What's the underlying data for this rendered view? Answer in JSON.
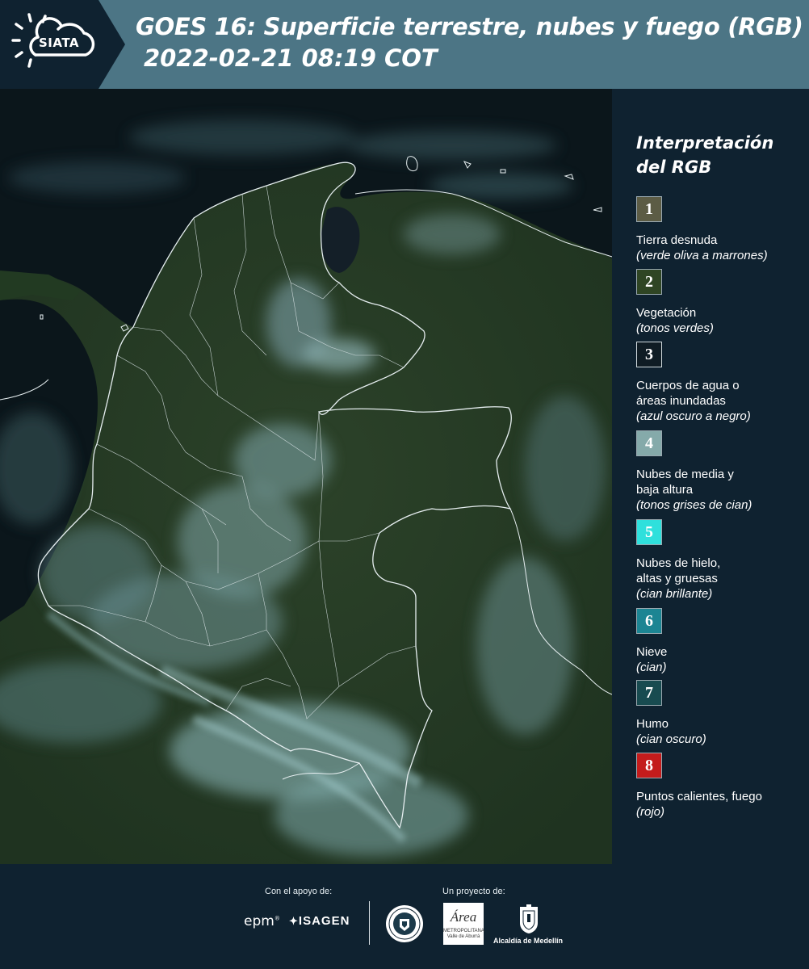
{
  "header": {
    "logo_text": "SIATA",
    "title_line1": "GOES 16: Superficie terrestre, nubes y fuego (RGB)",
    "title_line2": "2022-02-21 08:19 COT"
  },
  "legend": {
    "title": "Interpretación del RGB",
    "items": [
      {
        "number": "1",
        "label": "Tierra desnuda",
        "sub": "(verde oliva a marrones)",
        "color": "#5c5c45"
      },
      {
        "number": "2",
        "label": "Vegetación",
        "sub": "(tonos verdes)",
        "color": "#2f4524"
      },
      {
        "number": "3",
        "label": "Cuerpos de agua o áreas inundadas",
        "sub": "(azul oscuro a negro)",
        "color": "#0f1c24"
      },
      {
        "number": "4",
        "label": "Nubes de media y baja altura",
        "sub": "(tonos grises de cian)",
        "color": "#85aaaa"
      },
      {
        "number": "5",
        "label": "Nubes de hielo, altas y gruesas",
        "sub": "(cian brillante)",
        "color": "#2fe0dc"
      },
      {
        "number": "6",
        "label": "Nieve",
        "sub": "(cian)",
        "color": "#1c8593"
      },
      {
        "number": "7",
        "label": "Humo",
        "sub": "(cian oscuro)",
        "color": "#184b50"
      },
      {
        "number": "8",
        "label": "Puntos calientes, fuego",
        "sub": "(rojo)",
        "color": "#c41c1c"
      }
    ]
  },
  "footer": {
    "support_label": "Con el apoyo de:",
    "project_label": "Un proyecto de:",
    "epm": "epm",
    "isagen": "ISAGEN",
    "area_logo": "Área",
    "area_sub": "METROPOLITANA Valle de Aburrá",
    "alcaldia": "Alcaldía de Medellín"
  },
  "colors": {
    "header_bg": "#4c7585",
    "panel_bg": "#0f2230",
    "land": "#263a24",
    "ocean": "#0a1418",
    "cloud": "#8fbcc0"
  }
}
